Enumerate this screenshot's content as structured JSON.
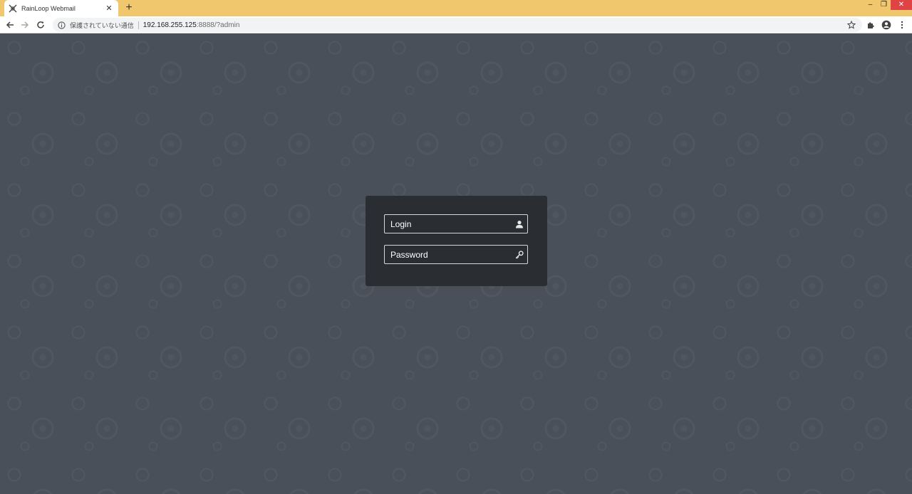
{
  "browser": {
    "tab": {
      "title": "RainLoop Webmail",
      "close_label": "✕",
      "favicon": "rainloop-logo-icon"
    },
    "new_tab_label": "+",
    "window_controls": {
      "minimize": "–",
      "restore": "❐",
      "close": "✕"
    },
    "toolbar": {
      "back_icon": "back-arrow-icon",
      "forward_icon": "forward-arrow-icon",
      "reload_icon": "reload-icon",
      "security_text": "保護されていない通信",
      "url_host": "192.168.255.125",
      "url_rest": ":8888/?admin",
      "bookmark_icon": "star-icon",
      "extensions_icon": "puzzle-icon",
      "profile_icon": "profile-icon",
      "menu_icon": "kebab-menu-icon"
    },
    "colors": {
      "titlebar": "#f0c76c",
      "close_button": "#e04343"
    }
  },
  "login_form": {
    "login_placeholder": "Login",
    "login_value": "",
    "login_icon": "user-icon",
    "password_placeholder": "Password",
    "password_value": "",
    "password_icon": "key-icon",
    "colors": {
      "page_background": "#4a5059",
      "box_background": "#2a2d31",
      "field_border": "#d7d7d7",
      "text": "#ffffff"
    }
  }
}
